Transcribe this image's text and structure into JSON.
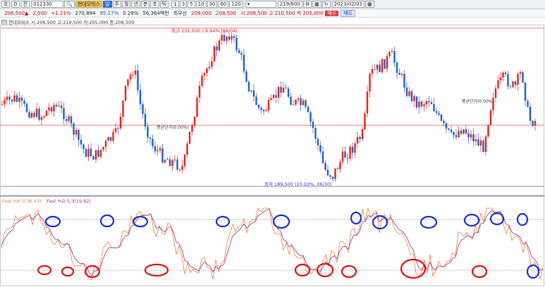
{
  "toolbar": {
    "menu": "☰",
    "prefix": "D",
    "market": "전",
    "code": "012330",
    "stock_name": "현대모비스",
    "period_buttons": [
      "일",
      "주",
      "월",
      "년",
      "분",
      "초",
      "틱"
    ],
    "interval_buttons": [
      "1",
      "3",
      "5",
      "10",
      "30",
      "60",
      "120"
    ],
    "count": "219/800",
    "date": "2023/02/03"
  },
  "quote": {
    "price": "208,500▲",
    "change": "2,500",
    "change_pct": "+1.21%",
    "volume": "270,894",
    "vol_ratio": "95.17%",
    "turnover_rate": "0.29%",
    "amount": "56,364백만",
    "first_priority_label": "최우선",
    "first_priority_values": [
      "209,000",
      "208,500"
    ],
    "ohlc": "시 206,500  고 210,500  저 205,000",
    "buy_label": "매수",
    "sell_label": "매도"
  },
  "price_legend": "현대모비스  시:206,500  고:210,500  저:205,000  종:208,500",
  "annotations": {
    "high": "최고 231,500 (-9.94%, 08/04)",
    "low": "최저 189,500 (10.03%, 06/30)",
    "balance_left": "평균단가(0.00%)",
    "balance_right": "평균단가(0.00%)"
  },
  "stochastic": {
    "k_label": "Fast %K 5(36.43)",
    "d_label": "Fast %D 5,3(19.82)"
  },
  "colors": {
    "up": "#e0221c",
    "down": "#1f5cc6",
    "k_line": "#f0803a",
    "d_line": "#9b2f86",
    "marker_red": "#e01010",
    "marker_blue": "#1a2fcf"
  }
}
